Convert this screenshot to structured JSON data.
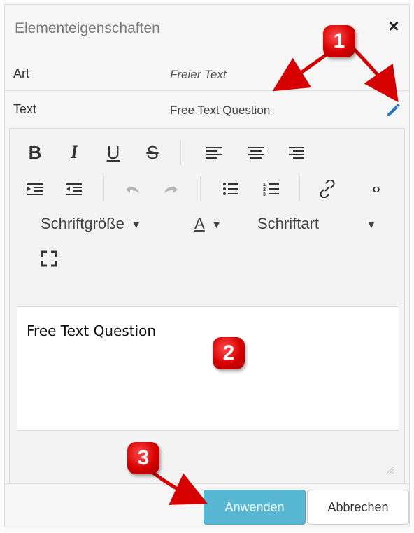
{
  "dialog": {
    "title": "Elementeigenschaften",
    "close_icon": "close-icon"
  },
  "properties": [
    {
      "label": "Art",
      "value": "Freier Text"
    },
    {
      "label": "Text",
      "value": "Free Text Question",
      "edit_icon": "pencil-icon"
    }
  ],
  "toolbar": {
    "buttons": [
      {
        "name": "bold",
        "label": "B"
      },
      {
        "name": "italic",
        "label": "I"
      },
      {
        "name": "underline",
        "label": "U"
      },
      {
        "name": "strikethrough",
        "label": "S"
      },
      {
        "name": "align-left",
        "label": "≡"
      },
      {
        "name": "align-center",
        "label": "≡"
      },
      {
        "name": "align-right",
        "label": "≡"
      },
      {
        "name": "indent",
        "label": "⇥"
      },
      {
        "name": "outdent",
        "label": "⇤"
      },
      {
        "name": "undo",
        "label": "↶"
      },
      {
        "name": "redo",
        "label": "↷"
      },
      {
        "name": "bulleted-list",
        "label": "•"
      },
      {
        "name": "numbered-list",
        "label": "1."
      },
      {
        "name": "link",
        "label": "⛓"
      },
      {
        "name": "source",
        "label": "<>"
      },
      {
        "name": "fullscreen",
        "label": "⛶"
      }
    ],
    "font_size_label": "Schriftgröße",
    "text_color_label": "A",
    "font_family_label": "Schriftart"
  },
  "editor": {
    "content": "Free Text Question"
  },
  "footer": {
    "apply_label": "Anwenden",
    "cancel_label": "Abbrechen"
  },
  "annotations": {
    "markers": [
      "1",
      "2",
      "3"
    ],
    "accent": "#d60000"
  }
}
